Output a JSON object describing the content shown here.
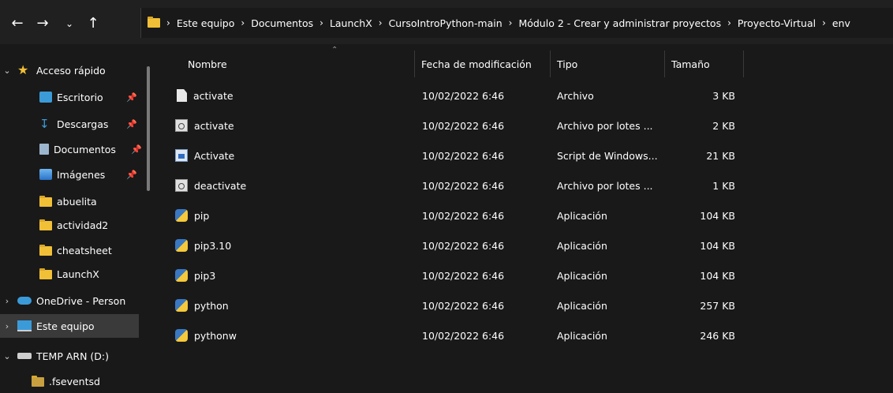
{
  "window": {
    "title": "env"
  },
  "nav": {
    "back_icon": "arrow-left-icon",
    "forward_icon": "arrow-right-icon",
    "recent_icon": "chevron-down-icon",
    "up_icon": "arrow-up-icon"
  },
  "address_bar": {
    "crumbs": [
      "Este equipo",
      "Documentos",
      "LaunchX",
      "CursoIntroPython-main",
      "Módulo 2 - Crear y administrar proyectos",
      "Proyecto-Virtual",
      "env"
    ]
  },
  "sidebar": {
    "items": [
      {
        "label": "Acceso rápido",
        "icon": "star-icon",
        "expandable": true,
        "expanded": true,
        "pinned": false
      },
      {
        "label": "Escritorio",
        "icon": "desktop-icon",
        "pinned": true
      },
      {
        "label": "Descargas",
        "icon": "download-icon",
        "pinned": true
      },
      {
        "label": "Documentos",
        "icon": "documents-icon",
        "pinned": true
      },
      {
        "label": "Imágenes",
        "icon": "pictures-icon",
        "pinned": true
      },
      {
        "label": "abuelita",
        "icon": "folder-icon"
      },
      {
        "label": "actividad2",
        "icon": "folder-icon"
      },
      {
        "label": "cheatsheet",
        "icon": "folder-icon"
      },
      {
        "label": "LaunchX",
        "icon": "folder-icon"
      },
      {
        "label": "OneDrive - Person",
        "icon": "cloud-icon",
        "expandable": true,
        "expanded": false
      },
      {
        "label": "Este equipo",
        "icon": "computer-icon",
        "expandable": true,
        "expanded": false,
        "selected": true
      },
      {
        "label": "TEMP ARN (D:)",
        "icon": "drive-icon",
        "expandable": true,
        "expanded": true
      },
      {
        "label": ".fseventsd",
        "icon": "folder-icon"
      }
    ]
  },
  "columns": {
    "name": "Nombre",
    "modified": "Fecha de modificación",
    "type": "Tipo",
    "size": "Tamaño"
  },
  "files": [
    {
      "name": "activate",
      "modified": "10/02/2022 6:46",
      "type": "Archivo",
      "size": "3 KB",
      "icon": "file-icon"
    },
    {
      "name": "activate",
      "modified": "10/02/2022 6:46",
      "type": "Archivo por lotes ...",
      "size": "2 KB",
      "icon": "batch-file-icon"
    },
    {
      "name": "Activate",
      "modified": "10/02/2022 6:46",
      "type": "Script de Windows...",
      "size": "21 KB",
      "icon": "powershell-script-icon"
    },
    {
      "name": "deactivate",
      "modified": "10/02/2022 6:46",
      "type": "Archivo por lotes ...",
      "size": "1 KB",
      "icon": "batch-file-icon"
    },
    {
      "name": "pip",
      "modified": "10/02/2022 6:46",
      "type": "Aplicación",
      "size": "104 KB",
      "icon": "python-app-icon"
    },
    {
      "name": "pip3.10",
      "modified": "10/02/2022 6:46",
      "type": "Aplicación",
      "size": "104 KB",
      "icon": "python-app-icon"
    },
    {
      "name": "pip3",
      "modified": "10/02/2022 6:46",
      "type": "Aplicación",
      "size": "104 KB",
      "icon": "python-app-icon"
    },
    {
      "name": "python",
      "modified": "10/02/2022 6:46",
      "type": "Aplicación",
      "size": "257 KB",
      "icon": "python-app-icon"
    },
    {
      "name": "pythonw",
      "modified": "10/02/2022 6:46",
      "type": "Aplicación",
      "size": "246 KB",
      "icon": "python-app-icon"
    }
  ],
  "colors": {
    "background": "#191919",
    "toolbar": "#202020",
    "folder": "#f2c037",
    "selection": "#3a3a3a",
    "text": "#ffffff"
  }
}
